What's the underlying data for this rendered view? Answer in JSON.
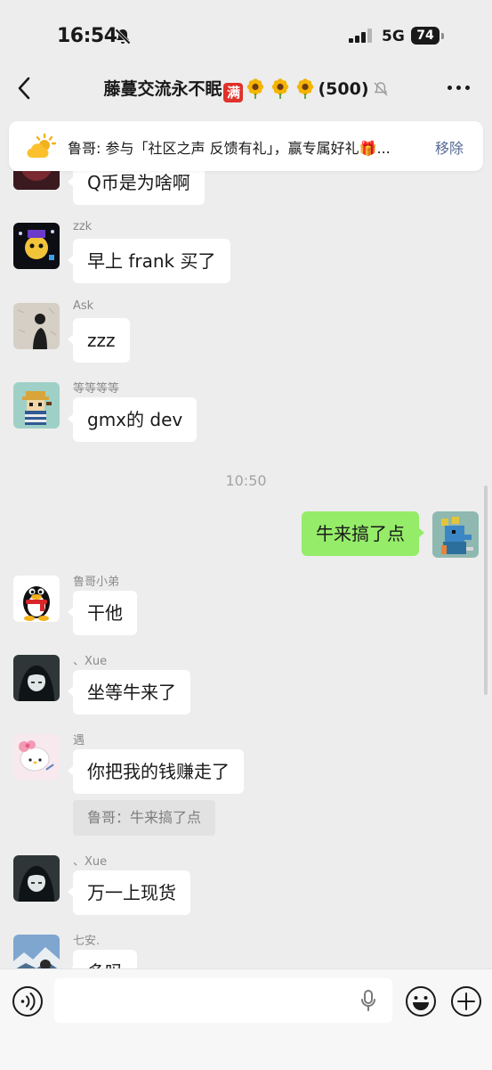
{
  "status_bar": {
    "time": "16:54",
    "network": "5G",
    "battery": "74"
  },
  "header": {
    "title": "藤蔓交流永不眠",
    "badge": "满",
    "member_count": "(500)"
  },
  "notice": {
    "text": "鲁哥: 参与「社区之声 反馈有礼」，赢专属好礼🎁...",
    "remove": "移除"
  },
  "messages": [
    {
      "text": "Q币是为啥啊"
    },
    {
      "sender": "zzk",
      "text": "早上 frank 买了"
    },
    {
      "sender": "Ask",
      "text": "zzz"
    },
    {
      "sender": "等等等等",
      "text": "gmx的 dev"
    },
    {
      "timestamp": "10:50"
    },
    {
      "text": "牛来搞了点",
      "mine": true
    },
    {
      "sender": "鲁哥小弟",
      "text": "干他"
    },
    {
      "sender": "、Xue",
      "text": "坐等牛来了"
    },
    {
      "sender": "遇",
      "text": "你把我的钱赚走了",
      "quote": "鲁哥：牛来搞了点"
    },
    {
      "sender": "、Xue",
      "text": "万一上现货"
    },
    {
      "sender": "七安.",
      "text": "多吗"
    }
  ],
  "colors": {
    "background": "#ededed",
    "my_bubble": "#95ec69",
    "link": "#576b95",
    "badge": "#e0312b"
  }
}
